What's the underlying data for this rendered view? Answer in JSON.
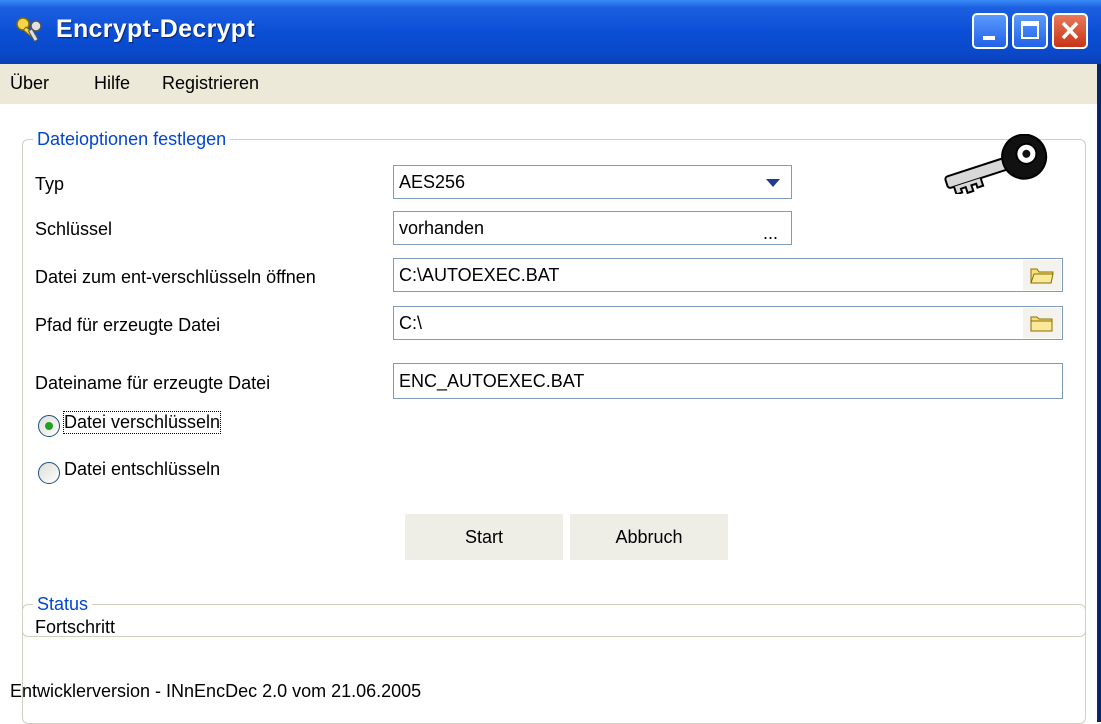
{
  "window": {
    "title": "Encrypt-Decrypt"
  },
  "menu": {
    "items": [
      "Über",
      "Hilfe",
      "Registrieren"
    ]
  },
  "file_options": {
    "legend": "Dateioptionen festlegen",
    "type_label": "Typ",
    "type_value": "AES256",
    "key_label": "Schlüssel",
    "key_value": "vorhanden",
    "key_browse": "...",
    "open_label": "Datei zum ent-verschlüsseln öffnen",
    "open_value": "C:\\AUTOEXEC.BAT",
    "path_label": "Pfad für erzeugte Datei",
    "path_value": "C:\\",
    "filename_label": "Dateiname für erzeugte Datei",
    "filename_value": "ENC_AUTOEXEC.BAT",
    "encrypt_label": "Datei verschlüsseln",
    "decrypt_label": "Datei entschlüsseln",
    "selected_mode": "encrypt",
    "start_label": "Start",
    "cancel_label": "Abbruch"
  },
  "status": {
    "legend": "Status",
    "progress_label": "Fortschritt"
  },
  "footer": {
    "version_text": "Entwicklerversion  - INnEncDec 2.0 vom 21.06.2005"
  },
  "icons": {
    "app": "keys-icon",
    "decoration": "key-icon",
    "folder": "folder-icon"
  },
  "colors": {
    "titlebar": "#0b4fd6",
    "group_legend": "#0046d5",
    "menubar": "#ece9d8",
    "button_face": "#efeee6",
    "radio_selected": "#21a121"
  }
}
